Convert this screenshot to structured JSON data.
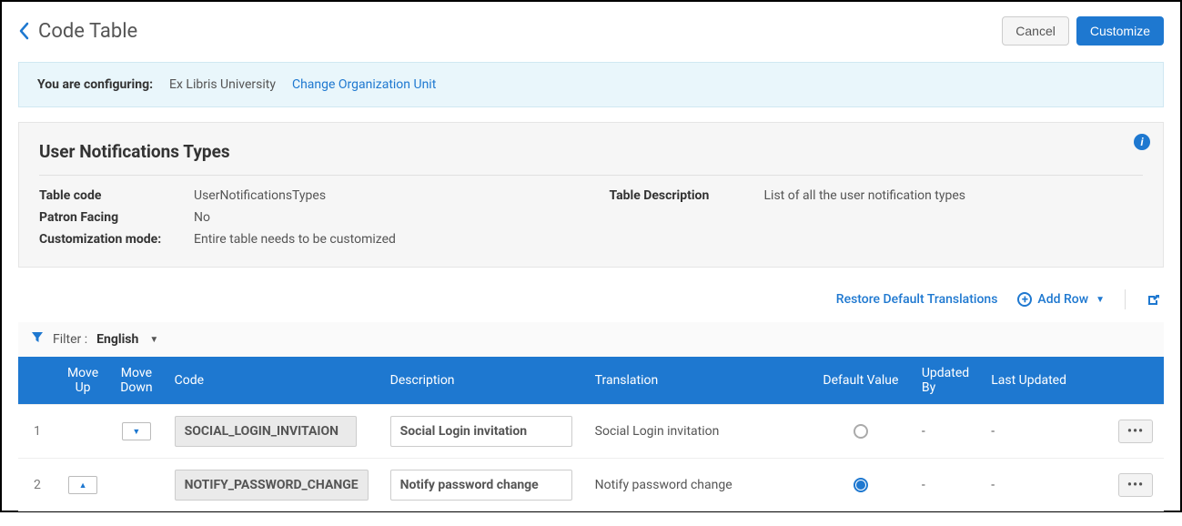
{
  "header": {
    "title": "Code Table",
    "cancel_label": "Cancel",
    "customize_label": "Customize"
  },
  "config_bar": {
    "label": "You are configuring:",
    "org_name": "Ex Libris University",
    "change_link": "Change Organization Unit"
  },
  "panel": {
    "title": "User Notifications Types",
    "left": {
      "table_code_label": "Table code",
      "table_code_value": "UserNotificationsTypes",
      "patron_label": "Patron Facing",
      "patron_value": "No",
      "mode_label": "Customization mode:",
      "mode_value": "Entire table needs to be customized"
    },
    "right": {
      "desc_label": "Table Description",
      "desc_value": "List of all the user notification types"
    }
  },
  "actions": {
    "restore": "Restore Default Translations",
    "add_row": "Add Row"
  },
  "filter": {
    "prefix": "Filter :",
    "value": "English"
  },
  "columns": {
    "move_up": "Move Up",
    "move_down": "Move Down",
    "code": "Code",
    "description": "Description",
    "translation": "Translation",
    "default_value": "Default Value",
    "updated_by": "Updated By",
    "last_updated": "Last Updated"
  },
  "rows": [
    {
      "n": "1",
      "code": "SOCIAL_LOGIN_INVITAION",
      "description": "Social Login invitation",
      "translation": "Social Login invitation",
      "default": false,
      "updated_by": "-",
      "last_updated": "-",
      "can_up": false,
      "can_down": true
    },
    {
      "n": "2",
      "code": "NOTIFY_PASSWORD_CHANGE",
      "description": "Notify password change",
      "translation": "Notify password change",
      "default": true,
      "updated_by": "-",
      "last_updated": "-",
      "can_up": true,
      "can_down": false
    }
  ]
}
